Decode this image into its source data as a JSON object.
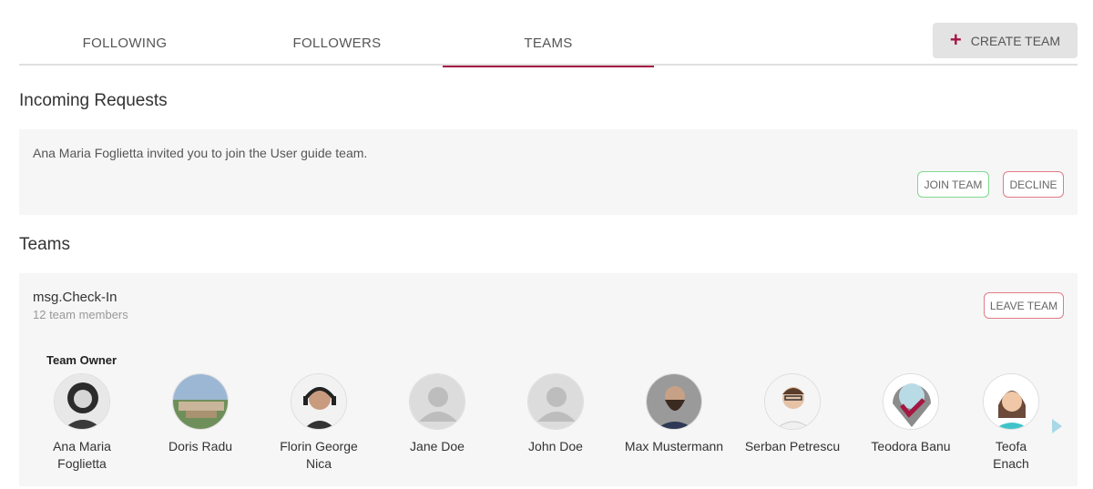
{
  "tabs": [
    {
      "label": "FOLLOWING",
      "active": false
    },
    {
      "label": "FOLLOWERS",
      "active": false
    },
    {
      "label": "TEAMS",
      "active": true
    }
  ],
  "create_team": {
    "label": "CREATE TEAM",
    "icon": "plus-icon"
  },
  "incoming": {
    "title": "Incoming Requests",
    "message": "Ana Maria Foglietta invited you to join the User guide team.",
    "join_label": "JOIN TEAM",
    "decline_label": "DECLINE"
  },
  "teams": {
    "title": "Teams",
    "team_name": "msg.Check-In",
    "member_count": "12 team members",
    "leave_label": "LEAVE TEAM",
    "owner_label": "Team Owner",
    "members": [
      {
        "line1": "Ana Maria",
        "line2": "Foglietta"
      },
      {
        "line1": "Doris Radu",
        "line2": ""
      },
      {
        "line1": "Florin George",
        "line2": "Nica"
      },
      {
        "line1": "Jane Doe",
        "line2": ""
      },
      {
        "line1": "John Doe",
        "line2": ""
      },
      {
        "line1": "Max Mustermann",
        "line2": ""
      },
      {
        "line1": "Serban Petrescu",
        "line2": ""
      },
      {
        "line1": "Teodora Banu",
        "line2": ""
      },
      {
        "line1": "Teofa",
        "line2": "Enach"
      }
    ]
  },
  "colors": {
    "accent": "#a41742",
    "join_border": "#7fd88f",
    "decline_border": "#e27b84",
    "card_bg": "#f6f6f6"
  }
}
